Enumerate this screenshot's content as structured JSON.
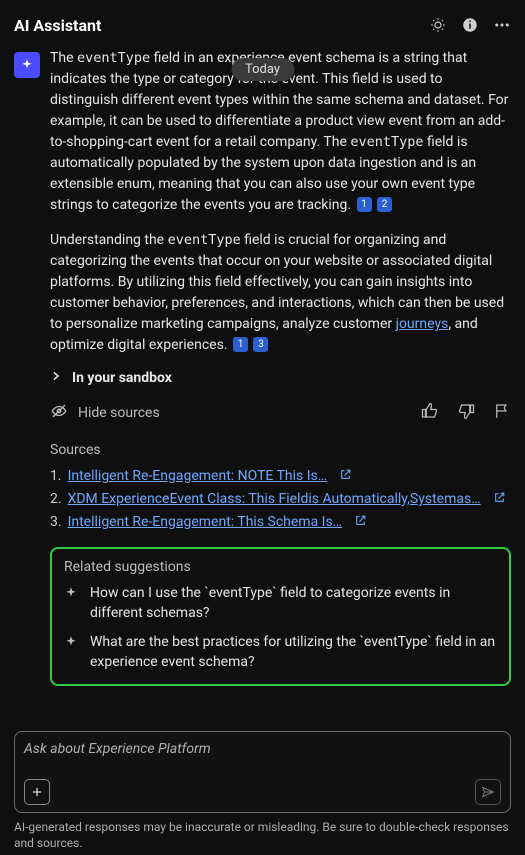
{
  "header": {
    "title": "AI Assistant"
  },
  "date_pill": "Today",
  "response": {
    "p1_a": "The ",
    "p1_code1": "eventType",
    "p1_b": " field in an experience event schema is a string that indicates the type or category for the event. This field is used to distinguish different event types within the same schema and dataset. For example, it can be used to differentiate a product view event from an add-to-shopping-cart event for a retail company. The ",
    "p1_code2": "eventType",
    "p1_c": " field is automatically populated by the system upon data ingestion and is an extensible enum, meaning that you can also use your own event type strings to categorize the events you are tracking.",
    "p1_refs": [
      "1",
      "2"
    ],
    "p2_a": "Understanding the ",
    "p2_code1": "eventType",
    "p2_b": " field is crucial for organizing and categorizing the events that occur on your website or associated digital platforms. By utilizing this field effectively, you can gain insights into customer behavior, preferences, and interactions, which can then be used to personalize marketing campaigns, analyze customer ",
    "p2_link": "journeys",
    "p2_c": ", and optimize digital experiences.",
    "p2_refs": [
      "1",
      "3"
    ]
  },
  "sandbox_label": "In your sandbox",
  "hide_sources_label": "Hide sources",
  "sources_title": "Sources",
  "sources": [
    {
      "n": "1.",
      "text": "Intelligent Re-Engagement: NOTE This Is…"
    },
    {
      "n": "2.",
      "text": "XDM ExperienceEvent Class: This Fieldis Automatically,Systemas…"
    },
    {
      "n": "3.",
      "text": "Intelligent Re-Engagement: This Schema Is…"
    }
  ],
  "related": {
    "title": "Related suggestions",
    "items": [
      "How can I use the `eventType` field to categorize events in different schemas?",
      "What are the best practices for utilizing the `eventType` field in an experience event schema?"
    ]
  },
  "input": {
    "placeholder": "Ask about Experience Platform"
  },
  "disclaimer": "AI-generated responses may be inaccurate or misleading. Be sure to double-check responses and sources."
}
